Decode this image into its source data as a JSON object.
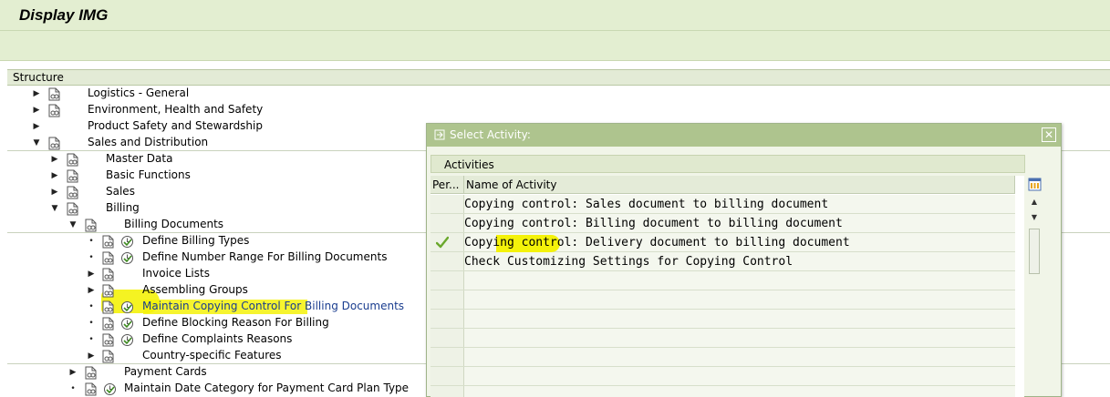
{
  "window": {
    "title": "Display IMG"
  },
  "structure": {
    "header": "Structure",
    "items": [
      {
        "label": "Logistics - General",
        "expanded": false,
        "execute": false
      },
      {
        "label": "Environment, Health and Safety",
        "expanded": false,
        "execute": false
      },
      {
        "label": "Product Safety and Stewardship",
        "expanded": false,
        "execute": false
      },
      {
        "label": "Sales and Distribution",
        "expanded": true,
        "execute": false
      },
      {
        "label": "Master Data",
        "expanded": false,
        "execute": false
      },
      {
        "label": "Basic Functions",
        "expanded": false,
        "execute": false
      },
      {
        "label": "Sales",
        "expanded": false,
        "execute": false
      },
      {
        "label": "Billing",
        "expanded": true,
        "execute": false
      },
      {
        "label": "Billing Documents",
        "expanded": true,
        "execute": false
      },
      {
        "label": "Define Billing Types",
        "expanded": false,
        "execute": true
      },
      {
        "label": "Define Number Range For Billing Documents",
        "expanded": false,
        "execute": true
      },
      {
        "label": "Invoice Lists",
        "expanded": false,
        "execute": false
      },
      {
        "label": "Assembling Groups",
        "expanded": false,
        "execute": false
      },
      {
        "label": "Maintain Copying Control For Billing Documents",
        "expanded": false,
        "execute": true,
        "selected": true
      },
      {
        "label": "Define Blocking Reason For Billing",
        "expanded": false,
        "execute": true
      },
      {
        "label": "Define Complaints Reasons",
        "expanded": false,
        "execute": true
      },
      {
        "label": "Country-specific Features",
        "expanded": false,
        "execute": false
      },
      {
        "label": "Payment Cards",
        "expanded": false,
        "execute": false
      },
      {
        "label": "Maintain Date Category for Payment Card Plan Type",
        "expanded": false,
        "execute": true
      }
    ]
  },
  "dialog": {
    "title": "Select Activity:",
    "close_icon": "close-icon",
    "section_label": "Activities",
    "columns": {
      "performed": "Per...",
      "name": "Name of Activity"
    },
    "rows": [
      {
        "name": "Copying control: Sales document to billing document",
        "performed": false
      },
      {
        "name": "Copying control: Billing document to billing document",
        "performed": false
      },
      {
        "name": "Copying control: Delivery document to billing document",
        "performed": true
      },
      {
        "name": "Check Customizing Settings for Copying Control",
        "performed": false
      }
    ]
  },
  "colors": {
    "header_bg": "#e3eed1",
    "dialog_title_bg": "#aec48e",
    "highlight": "#f4f20a",
    "link_blue": "#1a3d8f",
    "check_green": "#6aa82c"
  }
}
